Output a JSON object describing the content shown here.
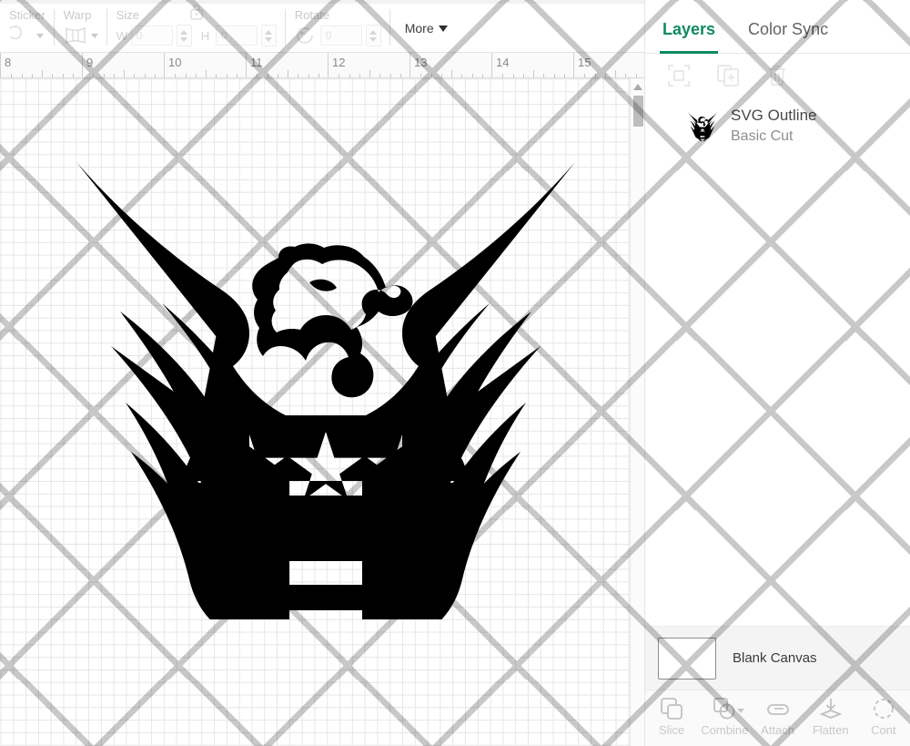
{
  "toolbar": {
    "groups": [
      {
        "label": "Sticker",
        "icon": "sticker-icon",
        "has_caret": true
      },
      {
        "label": "Warp",
        "icon": "warp-icon",
        "has_caret": true
      },
      {
        "label": "Size",
        "icon": "lock-icon",
        "width_letter": "W",
        "width_value": "0",
        "height_letter": "H",
        "height_value": "0"
      },
      {
        "label": "Rotate",
        "icon": "rotate-icon",
        "value": "0"
      }
    ],
    "more_label": "More",
    "more_caret_icon": "chevron-down-icon"
  },
  "ruler": {
    "marks": [
      "8",
      "9",
      "10",
      "11",
      "12",
      "13",
      "14",
      "15"
    ],
    "unit_spacing_px": 90,
    "start_x": 0,
    "minor_ticks_per_unit": 8
  },
  "canvas": {
    "grid_visible": true,
    "grid_size_px": 13.8,
    "artwork_name": "eagle-crest-svg",
    "artwork_color": "#000000",
    "background": "#ffffff",
    "scrollbar": {
      "up_arrow_icon": "chevron-up-icon",
      "thumb_name": "vertical-scroll-thumb"
    }
  },
  "panel": {
    "tabs": [
      {
        "label": "Layers",
        "active": true
      },
      {
        "label": "Color Sync",
        "active": false
      }
    ],
    "accent_color": "#0f8a5f",
    "actions": [
      {
        "name": "group-icon",
        "label": "Group"
      },
      {
        "name": "duplicate-icon",
        "label": "Duplicate"
      },
      {
        "name": "delete-icon",
        "label": "Delete"
      }
    ],
    "layers": [
      {
        "title": "SVG Outline",
        "subtitle": "Basic Cut",
        "thumb": "eagle-crest-thumbnail"
      }
    ],
    "canvas_row": {
      "label": "Blank Canvas",
      "thumb_color": "#ffffff"
    }
  },
  "bottom_bar": {
    "items": [
      {
        "label": "Slice",
        "icon": "slice-icon",
        "has_caret": false
      },
      {
        "label": "Combine",
        "icon": "combine-icon",
        "has_caret": true
      },
      {
        "label": "Attach",
        "icon": "attach-icon",
        "has_caret": false
      },
      {
        "label": "Flatten",
        "icon": "flatten-icon",
        "has_caret": false
      },
      {
        "label": "Cont",
        "icon": "contour-icon",
        "has_caret": false
      }
    ]
  }
}
